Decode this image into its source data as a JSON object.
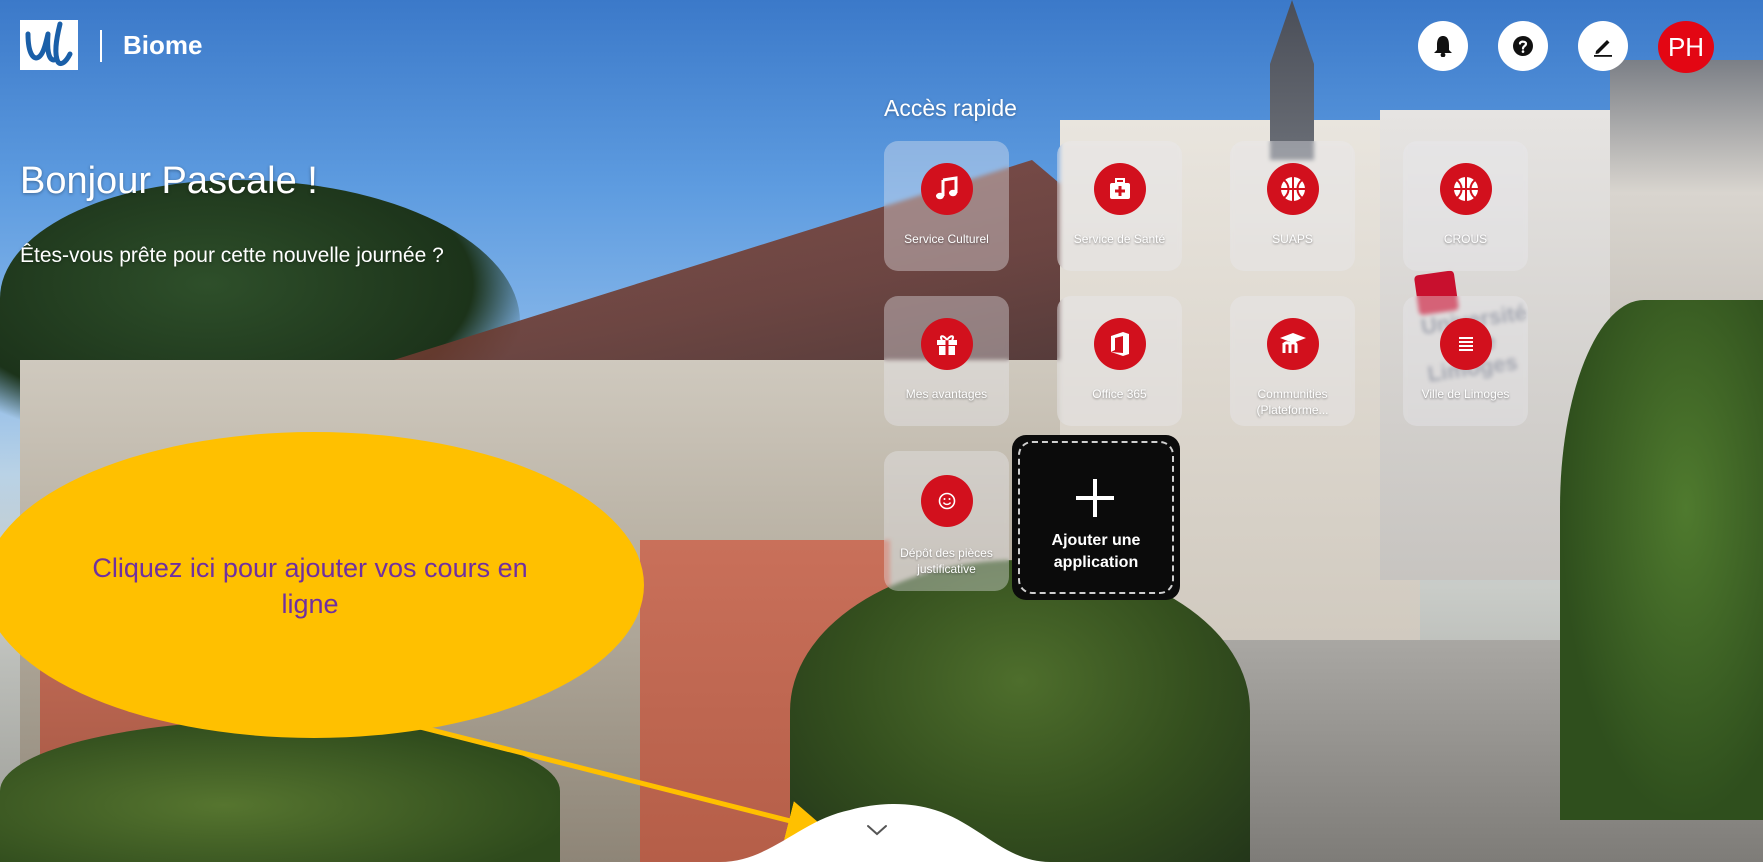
{
  "header": {
    "app_name": "Biome",
    "logo": "ul-logo",
    "icons": [
      "bell-icon",
      "question-icon",
      "pencil-icon"
    ],
    "avatar_initials": "PH",
    "avatar_color": "#e30613"
  },
  "greeting": {
    "title": "Bonjour Pascale !",
    "subtitle": "Êtes-vous prête pour cette nouvelle journée ?"
  },
  "quick_access": {
    "title": "Accès rapide",
    "accent_color": "#d2101d",
    "apps": [
      {
        "label": "Service Culturel",
        "icon": "music-note-icon"
      },
      {
        "label": "Service de Santé",
        "icon": "medical-kit-icon"
      },
      {
        "label": "SUAPS",
        "icon": "basketball-icon"
      },
      {
        "label": "CROUS",
        "icon": "basketball-icon"
      },
      {
        "label": "Mes avantages",
        "icon": "gift-icon"
      },
      {
        "label": "Office 365",
        "icon": "office-icon"
      },
      {
        "label": "Communities (Plateforme...",
        "icon": "graduation-cap-icon"
      },
      {
        "label": "Ville de Limoges",
        "icon": "list-icon"
      },
      {
        "label": "Dépôt des pièces justificative",
        "icon": "smiley-icon"
      }
    ],
    "add_app_label": "Ajouter une application"
  },
  "background_sign": {
    "line1": "Université",
    "line2": "de Limoges"
  },
  "callout": {
    "text": "Cliquez ici pour ajouter vos cours en ligne",
    "fill_color": "#ffc000",
    "text_color": "#7030a0"
  },
  "scroll": {
    "icon": "chevron-down-icon"
  }
}
